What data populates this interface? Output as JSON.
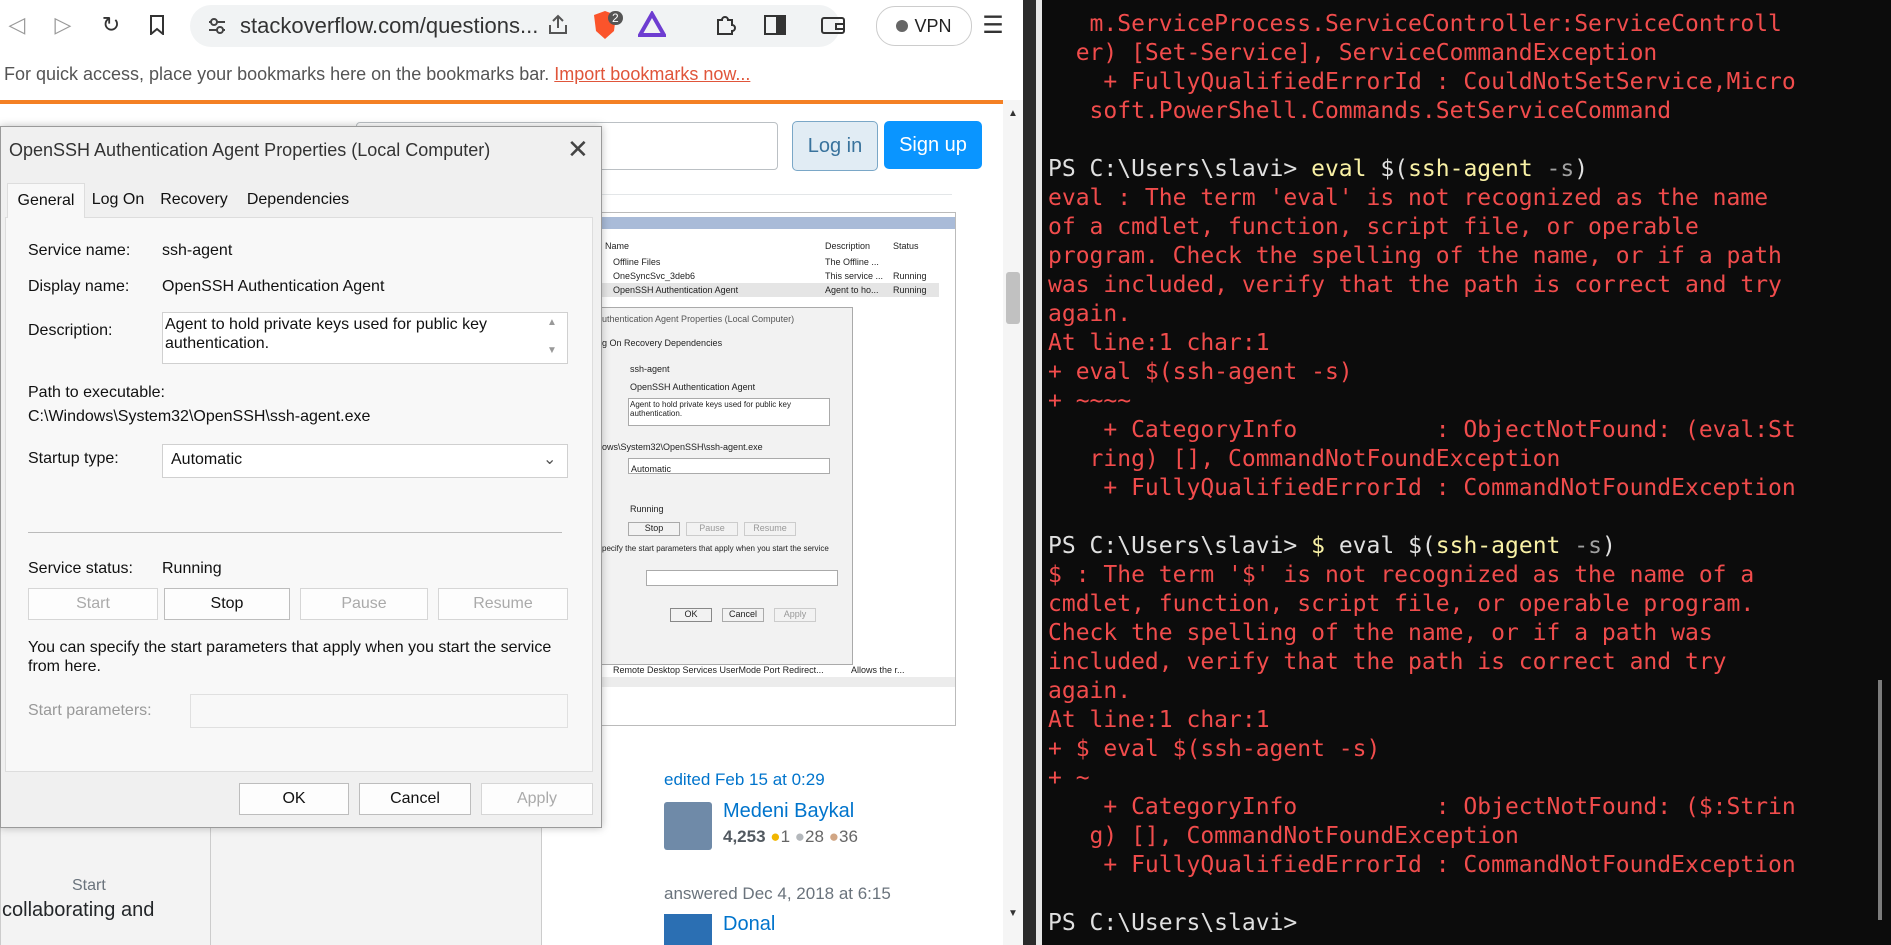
{
  "browser": {
    "url": "stackoverflow.com/questions...",
    "vpn_label": "VPN",
    "brave_badge": "2",
    "bookmarks_hint": "For quick access, place your bookmarks here on the bookmarks bar.",
    "import_link": "Import bookmarks now...",
    "login_label": "Log in",
    "signup_label": "Sign up"
  },
  "dialog": {
    "title": "OpenSSH Authentication Agent Properties (Local Computer)",
    "tabs": [
      "General",
      "Log On",
      "Recovery",
      "Dependencies"
    ],
    "service_name_label": "Service name:",
    "service_name": "ssh-agent",
    "display_name_label": "Display name:",
    "display_name": "OpenSSH Authentication Agent",
    "description_label": "Description:",
    "description": "Agent to hold private keys used for public key authentication.",
    "path_label": "Path to executable:",
    "path": "C:\\Windows\\System32\\OpenSSH\\ssh-agent.exe",
    "startup_label": "Startup type:",
    "startup_value": "Automatic",
    "status_label": "Service status:",
    "status_value": "Running",
    "start_label": "Start",
    "stop_label": "Stop",
    "pause_label": "Pause",
    "resume_label": "Resume",
    "hint": "You can specify the start parameters that apply when you start the service from here.",
    "params_label": "Start parameters:",
    "ok_label": "OK",
    "cancel_label": "Cancel",
    "apply_label": "Apply"
  },
  "embedded": {
    "col_name": "Name",
    "col_desc": "Description",
    "col_status": "Status",
    "rows": [
      {
        "name": "Offline Files",
        "desc": "The Offline ...",
        "status": ""
      },
      {
        "name": "OneSyncSvc_3deb6",
        "desc": "This service ...",
        "status": "Running"
      },
      {
        "name": "OpenSSH Authentication Agent",
        "desc": "Agent to ho...",
        "status": "Running"
      }
    ],
    "mini_title": "uthentication Agent Properties (Local Computer)",
    "mini_tabs": "g On   Recovery   Dependencies",
    "mini_name": "ssh-agent",
    "mini_display": "OpenSSH Authentication Agent",
    "mini_desc": "Agent to hold private keys used for public key authentication.",
    "mini_path": "ows\\System32\\OpenSSH\\ssh-agent.exe",
    "mini_startup": "Automatic",
    "mini_status": "Running",
    "mini_stop": "Stop",
    "mini_pause": "Pause",
    "mini_resume": "Resume",
    "mini_hint": "pecify the start parameters that apply when you start the service",
    "mini_ok": "OK",
    "mini_cancel": "Cancel",
    "mini_apply": "Apply",
    "bottom_row": "Remote Desktop Services UserMode Port Redirect...",
    "bottom_desc": "Allows the r..."
  },
  "answer": {
    "edited": "edited Feb 15 at 0:29",
    "user1": "Medeni Baykal",
    "rep1": "4,253",
    "gold1": "1",
    "silver1": "28",
    "bronze1": "36",
    "answered": "answered Dec 4, 2018 at 6:15",
    "user2": "Donal",
    "teams_line1": "Start",
    "teams_line2": "collaborating and"
  },
  "terminal": {
    "lines": [
      {
        "cls": "red",
        "text": "   m.ServiceProcess.ServiceController:ServiceControll"
      },
      {
        "cls": "red",
        "text": "  er) [Set-Service], ServiceCommandException"
      },
      {
        "cls": "red",
        "text": "    + FullyQualifiedErrorId : CouldNotSetService,Micro"
      },
      {
        "cls": "red",
        "text": "   soft.PowerShell.Commands.SetServiceCommand"
      },
      {
        "cls": "blank",
        "text": " "
      },
      {
        "cls": "prompt1",
        "text": "PS C:\\Users\\slavi> "
      },
      {
        "cls": "red",
        "text": "eval : The term 'eval' is not recognized as the name"
      },
      {
        "cls": "red",
        "text": "of a cmdlet, function, script file, or operable"
      },
      {
        "cls": "red",
        "text": "program. Check the spelling of the name, or if a path"
      },
      {
        "cls": "red",
        "text": "was included, verify that the path is correct and try"
      },
      {
        "cls": "red",
        "text": "again."
      },
      {
        "cls": "red",
        "text": "At line:1 char:1"
      },
      {
        "cls": "red",
        "text": "+ eval $(ssh-agent -s)"
      },
      {
        "cls": "red",
        "text": "+ ~~~~"
      },
      {
        "cls": "red",
        "text": "    + CategoryInfo          : ObjectNotFound: (eval:St"
      },
      {
        "cls": "red",
        "text": "   ring) [], CommandNotFoundException"
      },
      {
        "cls": "red",
        "text": "    + FullyQualifiedErrorId : CommandNotFoundException"
      },
      {
        "cls": "blank",
        "text": " "
      },
      {
        "cls": "prompt2",
        "text": "PS C:\\Users\\slavi> "
      },
      {
        "cls": "red",
        "text": "$ : The term '$' is not recognized as the name of a"
      },
      {
        "cls": "red",
        "text": "cmdlet, function, script file, or operable program."
      },
      {
        "cls": "red",
        "text": "Check the spelling of the name, or if a path was"
      },
      {
        "cls": "red",
        "text": "included, verify that the path is correct and try"
      },
      {
        "cls": "red",
        "text": "again."
      },
      {
        "cls": "red",
        "text": "At line:1 char:1"
      },
      {
        "cls": "red",
        "text": "+ $ eval $(ssh-agent -s)"
      },
      {
        "cls": "red",
        "text": "+ ~"
      },
      {
        "cls": "red",
        "text": "    + CategoryInfo          : ObjectNotFound: ($:Strin"
      },
      {
        "cls": "red",
        "text": "   g) [], CommandNotFoundException"
      },
      {
        "cls": "red",
        "text": "    + FullyQualifiedErrorId : CommandNotFoundException"
      },
      {
        "cls": "blank",
        "text": " "
      },
      {
        "cls": "wht",
        "text": "PS C:\\Users\\slavi>"
      }
    ],
    "cmd1": {
      "a": "eval ",
      "b": "$(",
      "c": "ssh-agent",
      "d": " -s",
      "e": ")"
    },
    "cmd2": {
      "a": "$ ",
      "b": "eval ",
      "c": "$(",
      "d": "ssh-agent",
      "e": " -s",
      "f": ")"
    }
  }
}
